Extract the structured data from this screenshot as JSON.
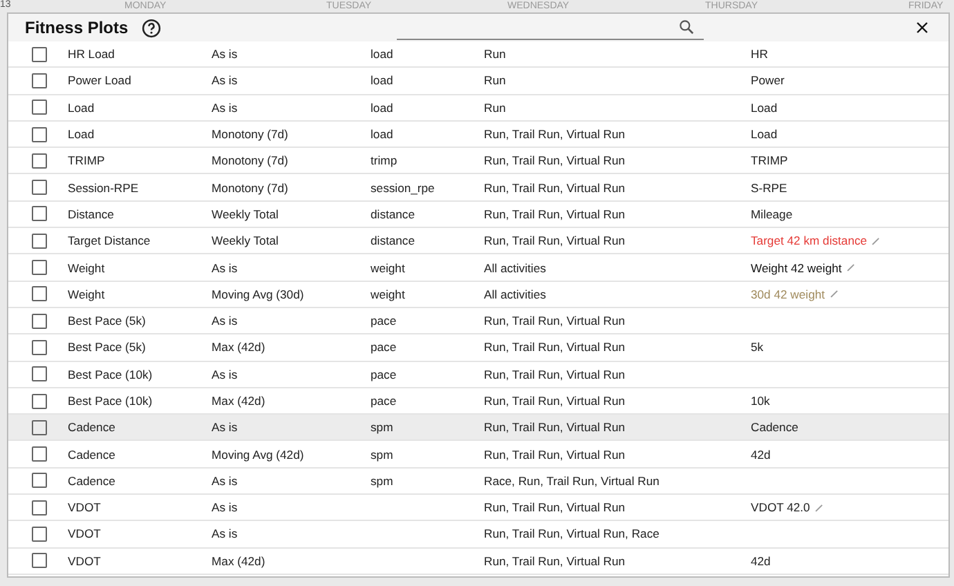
{
  "calendar": {
    "week_number": "13",
    "days": [
      "MONDAY",
      "TUESDAY",
      "WEDNESDAY",
      "THURSDAY",
      "FRIDAY"
    ]
  },
  "dialog": {
    "title": "Fitness Plots",
    "rows": [
      {
        "name": "HR Load",
        "aggregation": "As is",
        "field": "load",
        "types": "Run",
        "label": "HR",
        "editable": false,
        "checked": false,
        "highlighted": false
      },
      {
        "name": "Power Load",
        "aggregation": "As is",
        "field": "load",
        "types": "Run",
        "label": "Power",
        "editable": false,
        "checked": false,
        "highlighted": false
      },
      {
        "name": "Load",
        "aggregation": "As is",
        "field": "load",
        "types": "Run",
        "label": "Load",
        "editable": false,
        "checked": false,
        "highlighted": false
      },
      {
        "name": "Load",
        "aggregation": "Monotony (7d)",
        "field": "load",
        "types": "Run, Trail Run, Virtual Run",
        "label": "Load",
        "editable": false,
        "checked": false,
        "highlighted": false
      },
      {
        "name": "TRIMP",
        "aggregation": "Monotony (7d)",
        "field": "trimp",
        "types": "Run, Trail Run, Virtual Run",
        "label": "TRIMP",
        "editable": false,
        "checked": false,
        "highlighted": false
      },
      {
        "name": "Session-RPE",
        "aggregation": "Monotony (7d)",
        "field": "session_rpe",
        "types": "Run, Trail Run, Virtual Run",
        "label": "S-RPE",
        "editable": false,
        "checked": false,
        "highlighted": false
      },
      {
        "name": "Distance",
        "aggregation": "Weekly Total",
        "field": "distance",
        "types": "Run, Trail Run, Virtual Run",
        "label": "Mileage",
        "editable": false,
        "checked": false,
        "highlighted": false
      },
      {
        "name": "Target Distance",
        "aggregation": "Weekly Total",
        "field": "distance",
        "types": "Run, Trail Run, Virtual Run",
        "label": "Target 42 km distance",
        "editable": true,
        "color": "#e53935",
        "checked": false,
        "highlighted": false
      },
      {
        "name": "Weight",
        "aggregation": "As is",
        "field": "weight",
        "types": "All activities",
        "label": "Weight 42 weight",
        "editable": true,
        "color": "#111111",
        "checked": false,
        "highlighted": false
      },
      {
        "name": "Weight",
        "aggregation": "Moving Avg (30d)",
        "field": "weight",
        "types": "All activities",
        "label": "30d 42 weight",
        "editable": true,
        "color": "#a08a5c",
        "checked": false,
        "highlighted": false
      },
      {
        "name": "Best Pace (5k)",
        "aggregation": "As is",
        "field": "pace",
        "types": "Run, Trail Run, Virtual Run",
        "editable": false,
        "checked": false,
        "highlighted": false
      },
      {
        "name": "Best Pace (5k)",
        "aggregation": "Max (42d)",
        "field": "pace",
        "types": "Run, Trail Run, Virtual Run",
        "label": "5k",
        "editable": false,
        "checked": false,
        "highlighted": false
      },
      {
        "name": "Best Pace (10k)",
        "aggregation": "As is",
        "field": "pace",
        "types": "Run, Trail Run, Virtual Run",
        "editable": false,
        "checked": false,
        "highlighted": false
      },
      {
        "name": "Best Pace (10k)",
        "aggregation": "Max (42d)",
        "field": "pace",
        "types": "Run, Trail Run, Virtual Run",
        "label": "10k",
        "editable": false,
        "checked": false,
        "highlighted": false
      },
      {
        "name": "Cadence",
        "aggregation": "As is",
        "field": "spm",
        "types": "Run, Trail Run, Virtual Run",
        "label": "Cadence",
        "editable": false,
        "checked": false,
        "highlighted": true
      },
      {
        "name": "Cadence",
        "aggregation": "Moving Avg (42d)",
        "field": "spm",
        "types": "Run, Trail Run, Virtual Run",
        "label": "42d",
        "editable": false,
        "checked": false,
        "highlighted": false
      },
      {
        "name": "Cadence",
        "aggregation": "As is",
        "field": "spm",
        "types": "Race, Run, Trail Run, Virtual Run",
        "editable": false,
        "checked": false,
        "highlighted": false
      },
      {
        "name": "VDOT",
        "aggregation": "As is",
        "types": "Run, Trail Run, Virtual Run",
        "label": "VDOT 42.0",
        "editable": true,
        "checked": false,
        "highlighted": false
      },
      {
        "name": "VDOT",
        "aggregation": "As is",
        "types": "Run, Trail Run, Virtual Run, Race",
        "editable": false,
        "checked": false,
        "highlighted": false
      },
      {
        "name": "VDOT",
        "aggregation": "Max (42d)",
        "types": "Run, Trail Run, Virtual Run",
        "label": "42d",
        "editable": false,
        "checked": false,
        "highlighted": false
      }
    ]
  }
}
